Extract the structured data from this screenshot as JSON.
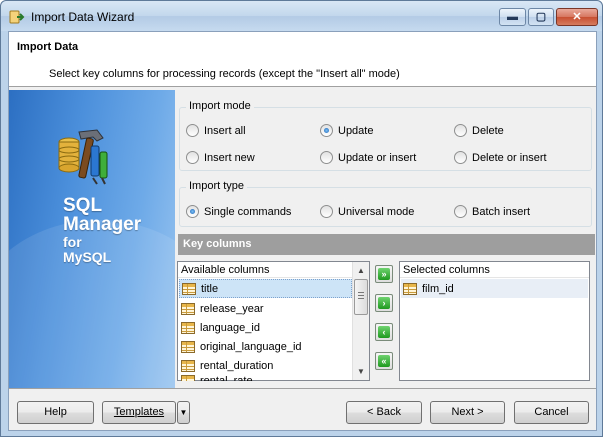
{
  "window": {
    "title": "Import Data Wizard",
    "min_glyph": "▬",
    "max_glyph": "▢",
    "close_glyph": "✕"
  },
  "header": {
    "title": "Import Data",
    "description": "Select key columns for processing records (except the \"Insert all\" mode)"
  },
  "banner": {
    "line1": "SQL",
    "line2": "Manager",
    "line3": "for",
    "line4": "MySQL"
  },
  "import_mode": {
    "label": "Import mode",
    "options": [
      {
        "label": "Insert all",
        "checked": false
      },
      {
        "label": "Update",
        "checked": true
      },
      {
        "label": "Delete",
        "checked": false
      },
      {
        "label": "Insert new",
        "checked": false
      },
      {
        "label": "Update or insert",
        "checked": false
      },
      {
        "label": "Delete or insert",
        "checked": false
      }
    ]
  },
  "import_type": {
    "label": "Import type",
    "options": [
      {
        "label": "Single commands",
        "checked": true
      },
      {
        "label": "Universal mode",
        "checked": false
      },
      {
        "label": "Batch insert",
        "checked": false
      }
    ]
  },
  "key_columns": {
    "title": "Key columns",
    "available_header": "Available columns",
    "available": [
      "title",
      "release_year",
      "language_id",
      "original_language_id",
      "rental_duration",
      "rental_rate"
    ],
    "selected_header": "Selected columns",
    "selected": [
      "film_id"
    ],
    "buttons": {
      "add_all": "»",
      "add": "›",
      "remove": "‹",
      "remove_all": "«"
    }
  },
  "footer": {
    "help": "Help",
    "templates": "Templates",
    "back": "< Back",
    "next": "Next >",
    "cancel": "Cancel"
  }
}
